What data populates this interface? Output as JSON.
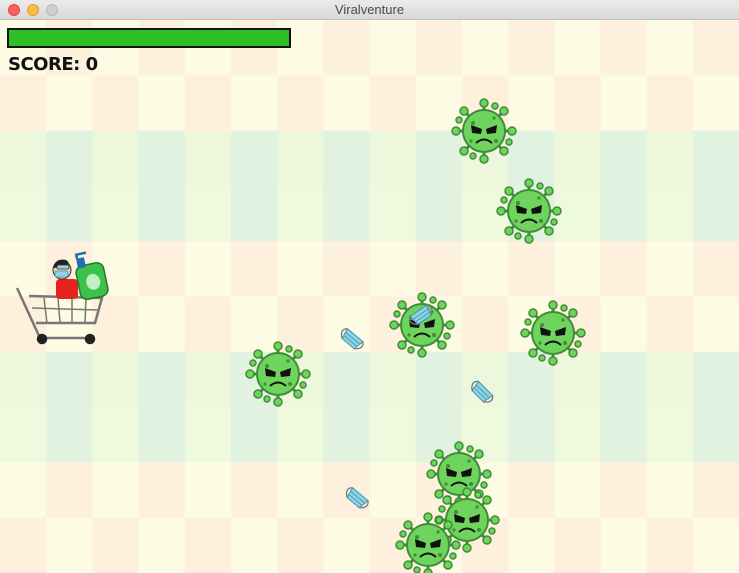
{
  "window": {
    "title": "Viralventure"
  },
  "hud": {
    "score_text": "SCORE: 0",
    "health": 1.0
  },
  "colors": {
    "health_fill": "#2ec126",
    "virus_body": "#6fd45e",
    "virus_outline": "#3f8d36",
    "mask": "#8ed3e6"
  },
  "entities": {
    "player": "player-in-cart-with-sanitizer",
    "virus_count": 8,
    "mask_count": 4
  }
}
